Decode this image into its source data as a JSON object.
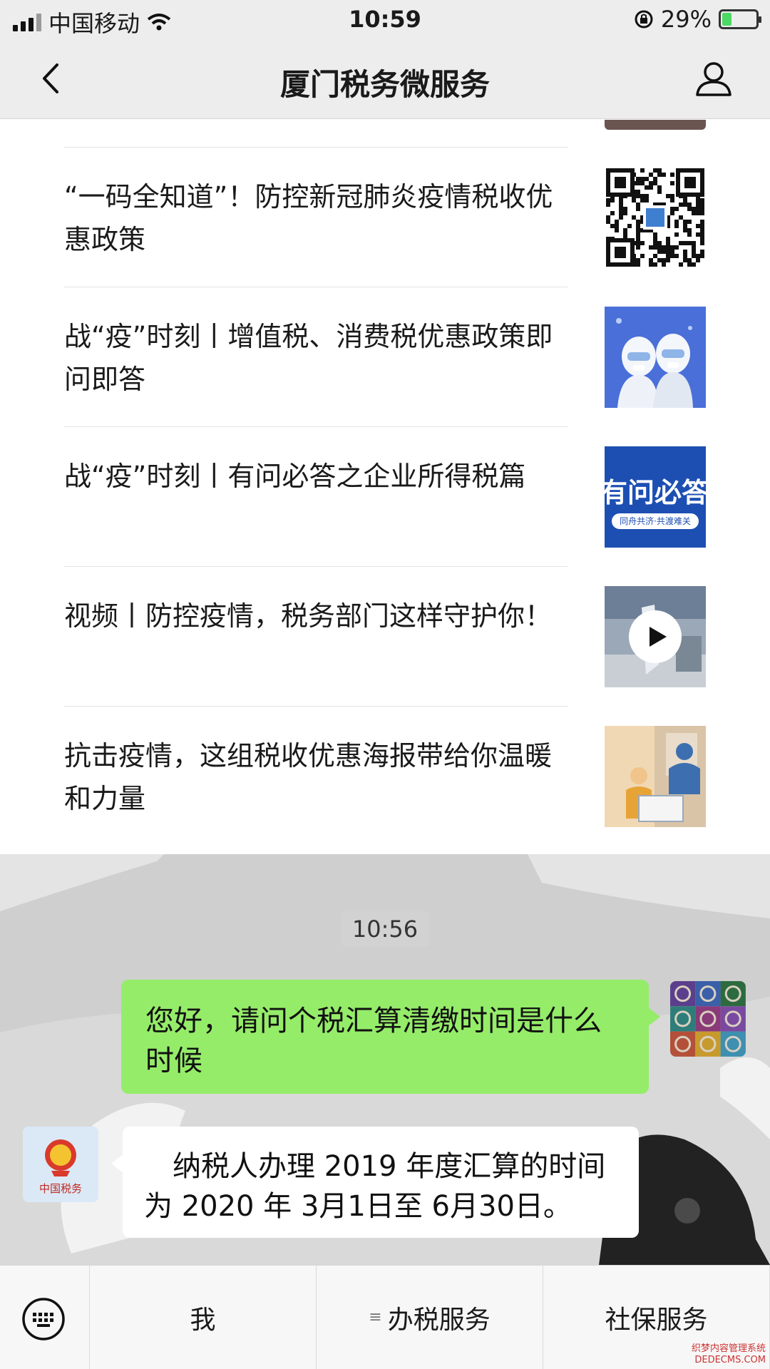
{
  "status_bar": {
    "carrier": "中国移动",
    "time": "10:59",
    "battery": "29%",
    "battery_level": 0.29,
    "icons": [
      "signal-icon",
      "wifi-icon",
      "orientation-lock-icon",
      "battery-icon"
    ]
  },
  "nav": {
    "title": "厦门税务微服务",
    "icons": [
      "back-chevron-icon",
      "user-profile-icon"
    ]
  },
  "articles": [
    {
      "title": "“一码全知道”！防控新冠肺炎疫情税收优惠政策",
      "thumb": "qr-code-thumb"
    },
    {
      "title": "战“疫”时刻丨增值税、消费税优惠政策即问即答",
      "thumb": "medical-workers-thumb"
    },
    {
      "title": "战“疫”时刻丨有问必答之企业所得税篇",
      "thumb": "banner-thumb",
      "thumb_text": "有问必答",
      "thumb_subtext": "同舟共济·共渡难关"
    },
    {
      "title": "视频丨防控疫情，税务部门这样守护你！",
      "thumb": "video-thumb"
    },
    {
      "title": "抗击疫情，这组税收优惠海报带给你温暖和力量",
      "thumb": "poster-thumb"
    }
  ],
  "chat": {
    "timestamp": "10:56",
    "outgoing": "您好，请问个税汇算清缴时间是什么时候",
    "incoming": "纳税人办理 2019 年度汇算的时间为 2020 年 3月1日至 6月30日。",
    "tax_logo_text": "中国税务"
  },
  "bottom_menu": {
    "keyboard_icon": "keyboard-icon",
    "items": [
      "我",
      "办税服务",
      "社保服务"
    ]
  },
  "watermark": {
    "line1": "织梦内容管理系统",
    "line2": "DEDECMS.COM"
  },
  "colors": {
    "bar_bg": "#ededed",
    "bubble_out": "#95ec69",
    "bubble_in": "#ffffff",
    "chat_bg": "#e4e4e4"
  }
}
